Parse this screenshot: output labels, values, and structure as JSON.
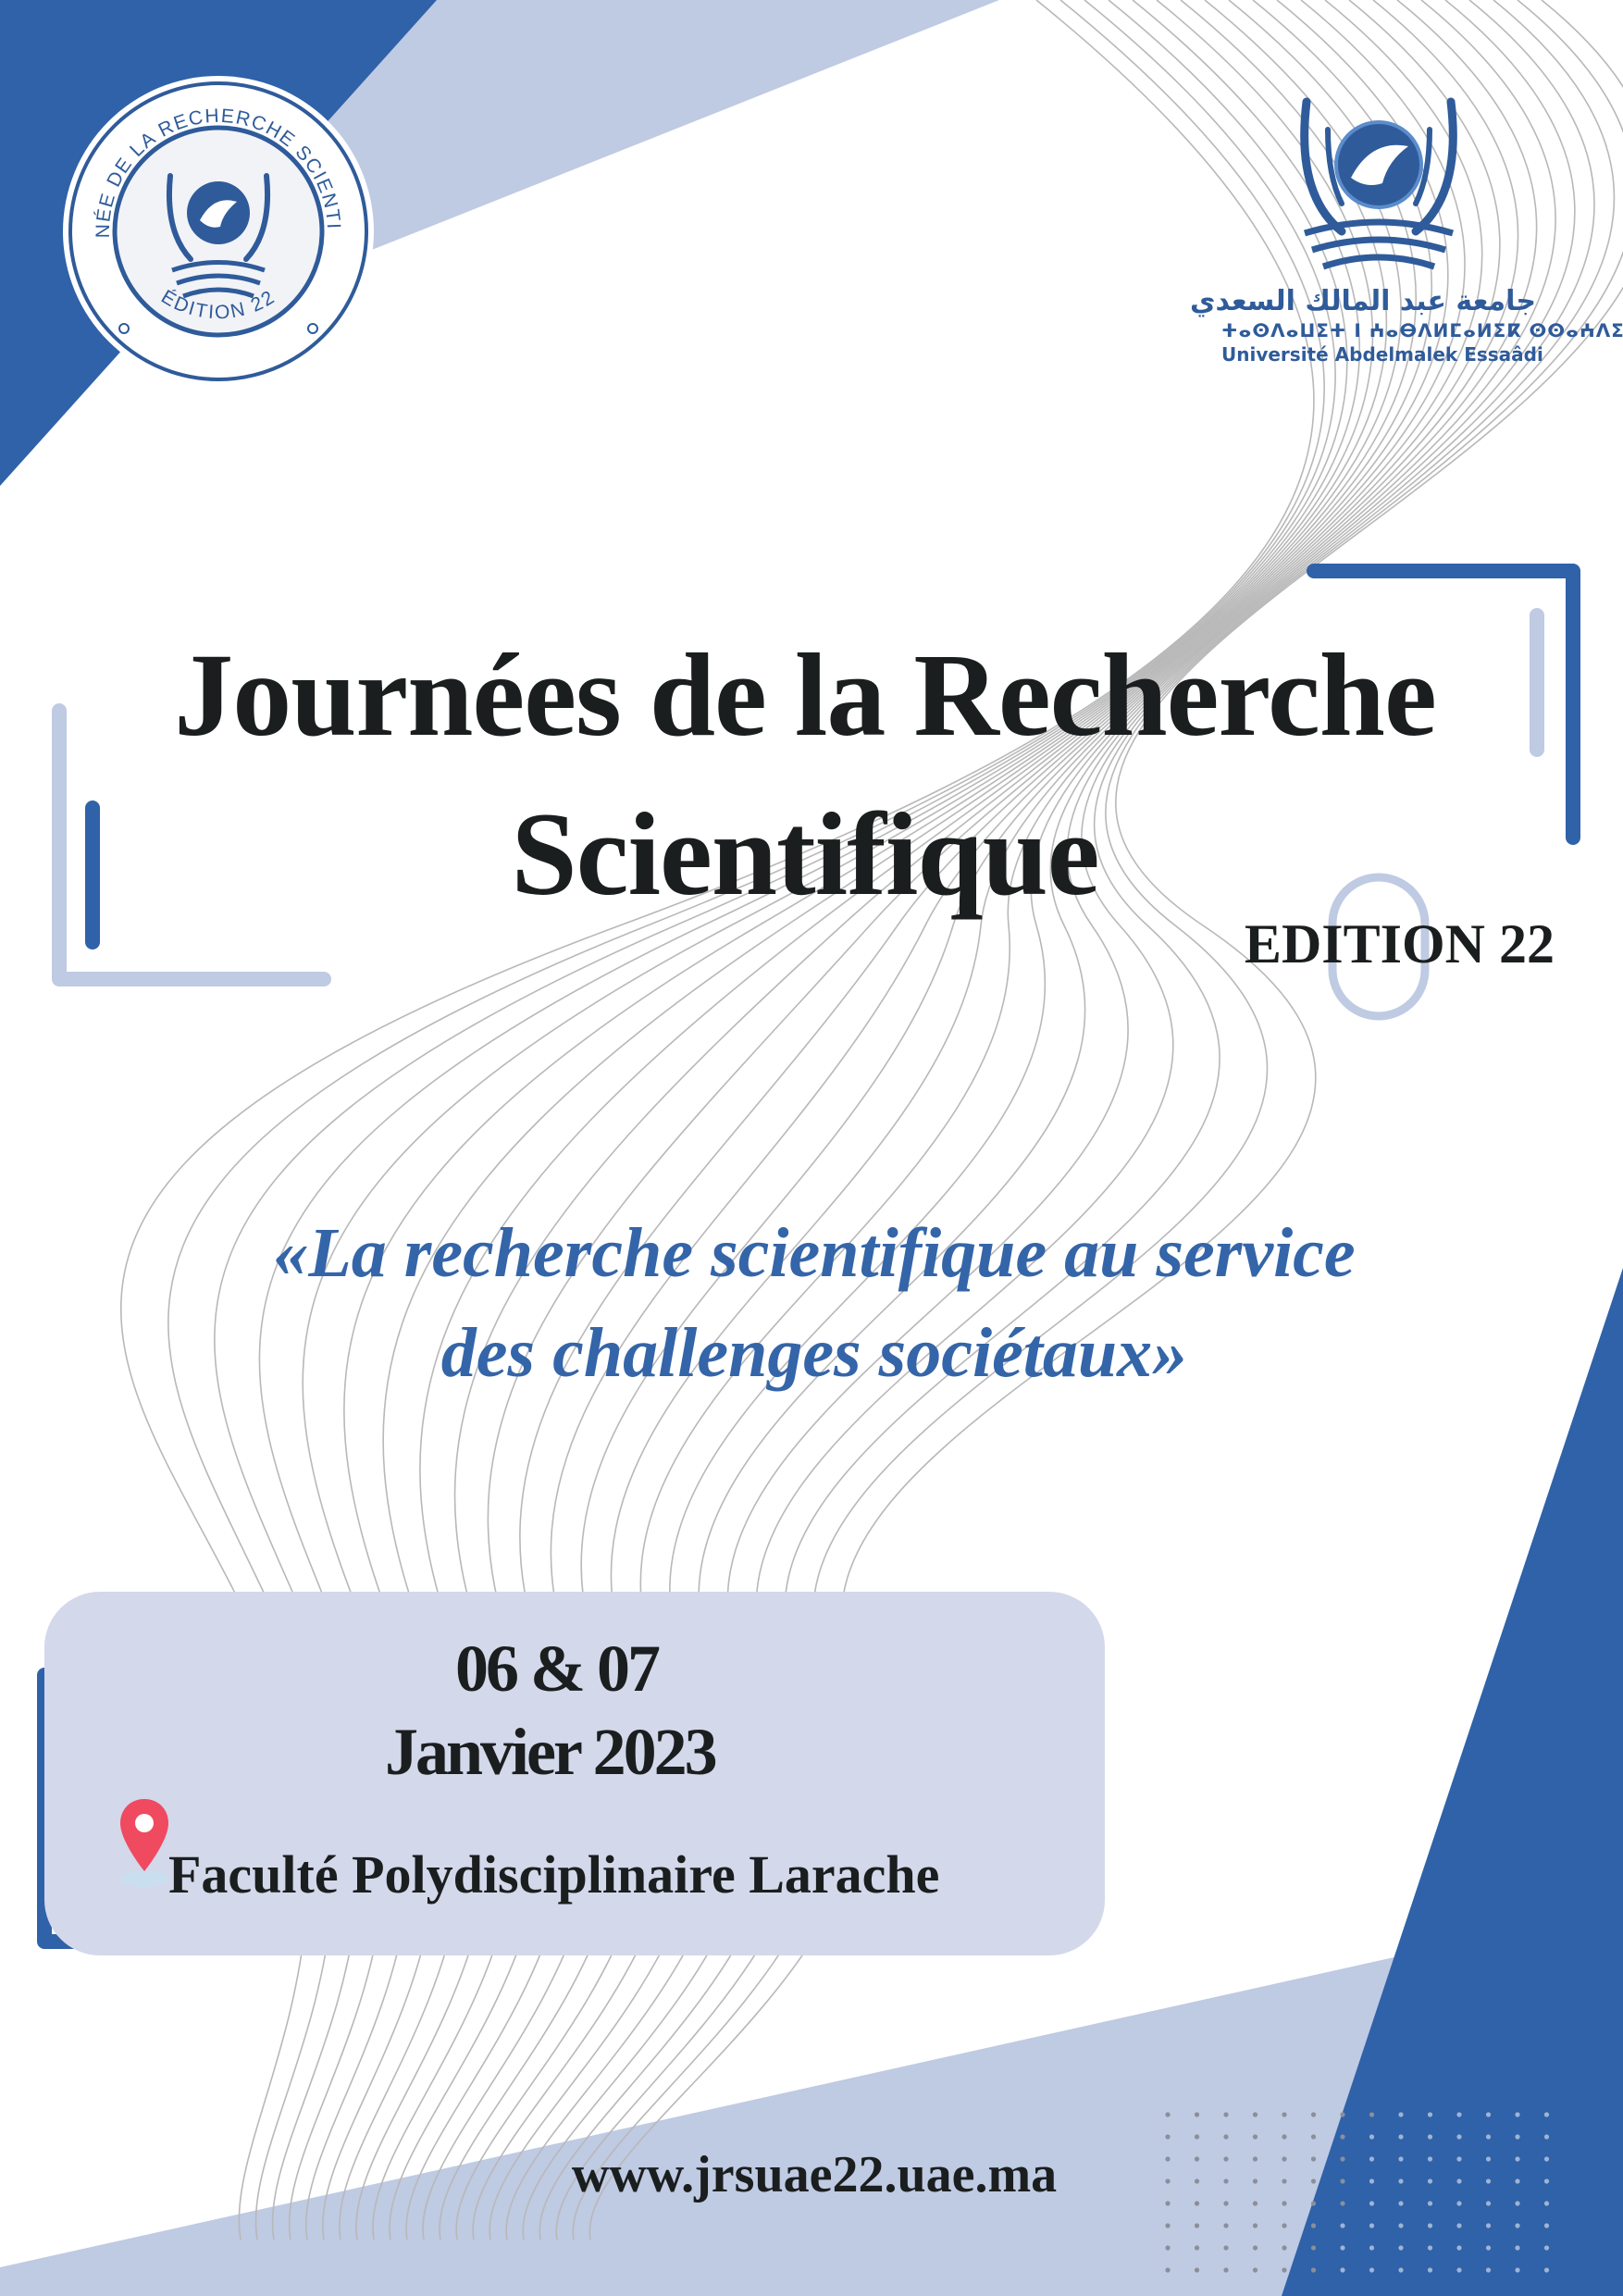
{
  "colors": {
    "primary_blue": "#2f62a8",
    "light_blue": "#bfcae3",
    "box_fill": "#d3d8ea",
    "title_text": "#1b1e1e",
    "theme_text": "#3465a8",
    "pin_red": "#ef4a5f"
  },
  "seal": {
    "ring_text": "JOURNÉE DE LA RECHERCHE SCIENTIFIQUE",
    "edition_text": "ÉDITION 22",
    "icon": "dove-globe-emblem-icon"
  },
  "university": {
    "name_arabic": "جامعة عبد المالك السعدي",
    "name_tifinagh": "ⵜⴰⵙⴷⴰⵡⵉⵜ ⵏ ⵄⴰⴱⴷⵍⵎⴰⵍⵉⴽ ⵙⵙⴰⵄⴷⵉ",
    "name_french": "Université Abdelmalek Essaâdi",
    "icon": "dove-globe-emblem-icon"
  },
  "title": {
    "line1": "Journées de la Recherche",
    "line2": "Scientifique",
    "edition": "EDITION 22"
  },
  "theme": {
    "line1": "«La recherche scientifique au service",
    "line2": "des challenges sociétaux»"
  },
  "event": {
    "dates_line1": "06 & 07",
    "dates_line2": "Janvier 2023",
    "location": "Faculté Polydisciplinaire Larache",
    "location_icon": "map-pin-icon"
  },
  "website": "www.jrsuae22.uae.ma"
}
